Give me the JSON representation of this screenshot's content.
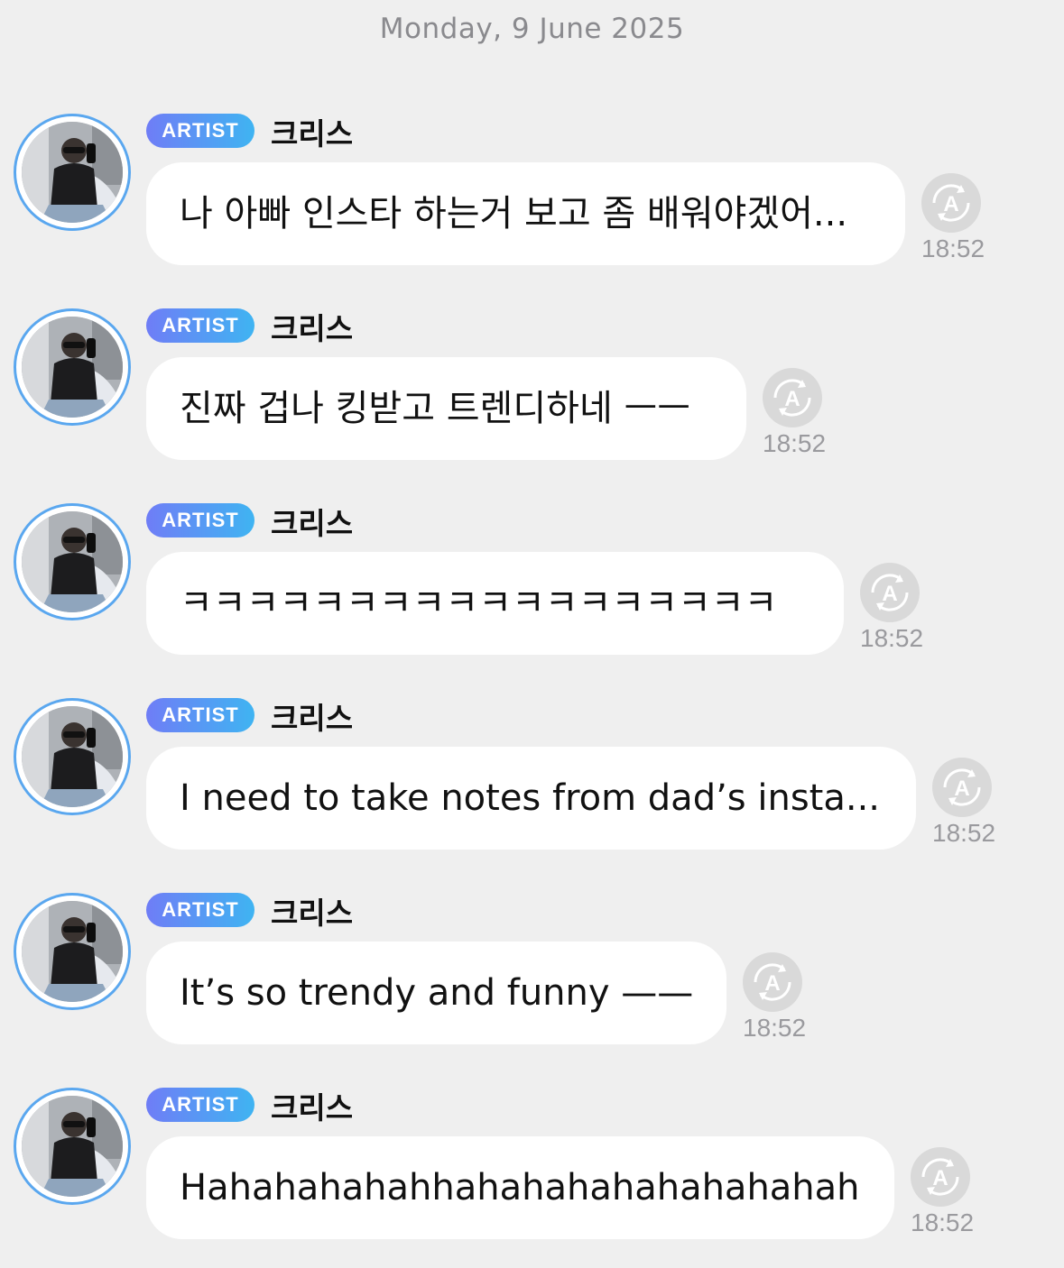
{
  "date_header": "Monday, 9 June 2025",
  "messages": [
    {
      "badge": "ARTIST",
      "sender": "크리스",
      "text": "나 아빠 인스타 하는거 보고 좀 배워야겠어...",
      "time": "18:52"
    },
    {
      "badge": "ARTIST",
      "sender": "크리스",
      "text": "진짜 겁나 킹받고 트렌디하네 ㅡㅡ",
      "time": "18:52"
    },
    {
      "badge": "ARTIST",
      "sender": "크리스",
      "text": "ㅋㅋㅋㅋㅋㅋㅋㅋㅋㅋㅋㅋㅋㅋㅋㅋㅋㅋ",
      "time": "18:52"
    },
    {
      "badge": "ARTIST",
      "sender": "크리스",
      "text": "I need to take notes from dad’s insta...",
      "time": "18:52"
    },
    {
      "badge": "ARTIST",
      "sender": "크리스",
      "text": "It’s so trendy and funny ——",
      "time": "18:52"
    },
    {
      "badge": "ARTIST",
      "sender": "크리스",
      "text": "Hahahahahahhahahahahahahahahah",
      "time": "18:52"
    }
  ],
  "icons": {
    "avatar": "artist-profile-photo",
    "translate": "translate-icon"
  },
  "colors": {
    "background": "#efefef",
    "badge_start": "#6f7df6",
    "badge_end": "#3fb4f2",
    "avatar_ring": "#5aa7ef",
    "bubble": "#ffffff",
    "translate_button": "#d9d9d9",
    "muted_text": "#9a9a9e"
  }
}
